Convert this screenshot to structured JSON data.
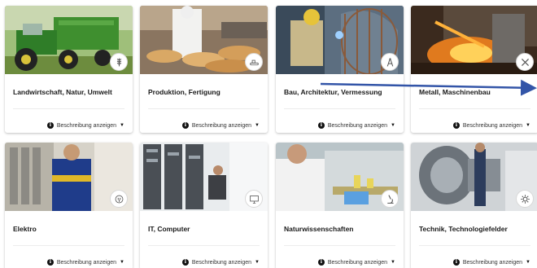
{
  "cards": [
    {
      "title": "Landwirtschaft, Natur, Umwelt",
      "desc": "Beschreibung anzeigen",
      "icon": "wheat-icon"
    },
    {
      "title": "Produktion, Fertigung",
      "desc": "Beschreibung anzeigen",
      "icon": "conveyor-icon"
    },
    {
      "title": "Bau, Architektur, Vermessung",
      "desc": "Beschreibung anzeigen",
      "icon": "compass-icon"
    },
    {
      "title": "Metall, Maschinenbau",
      "desc": "Beschreibung anzeigen",
      "icon": "tools-icon"
    },
    {
      "title": "Elektro",
      "desc": "Beschreibung anzeigen",
      "icon": "plug-icon"
    },
    {
      "title": "IT, Computer",
      "desc": "Beschreibung anzeigen",
      "icon": "monitor-icon"
    },
    {
      "title": "Naturwissenschaften",
      "desc": "Beschreibung anzeigen",
      "icon": "microscope-icon"
    },
    {
      "title": "Technik, Technologiefelder",
      "desc": "Beschreibung anzeigen",
      "icon": "gear-icon"
    }
  ],
  "info_glyph": "i",
  "caret_glyph": "▼",
  "colors": {
    "arrow": "#3355a8",
    "badge_icon": "#555555"
  }
}
